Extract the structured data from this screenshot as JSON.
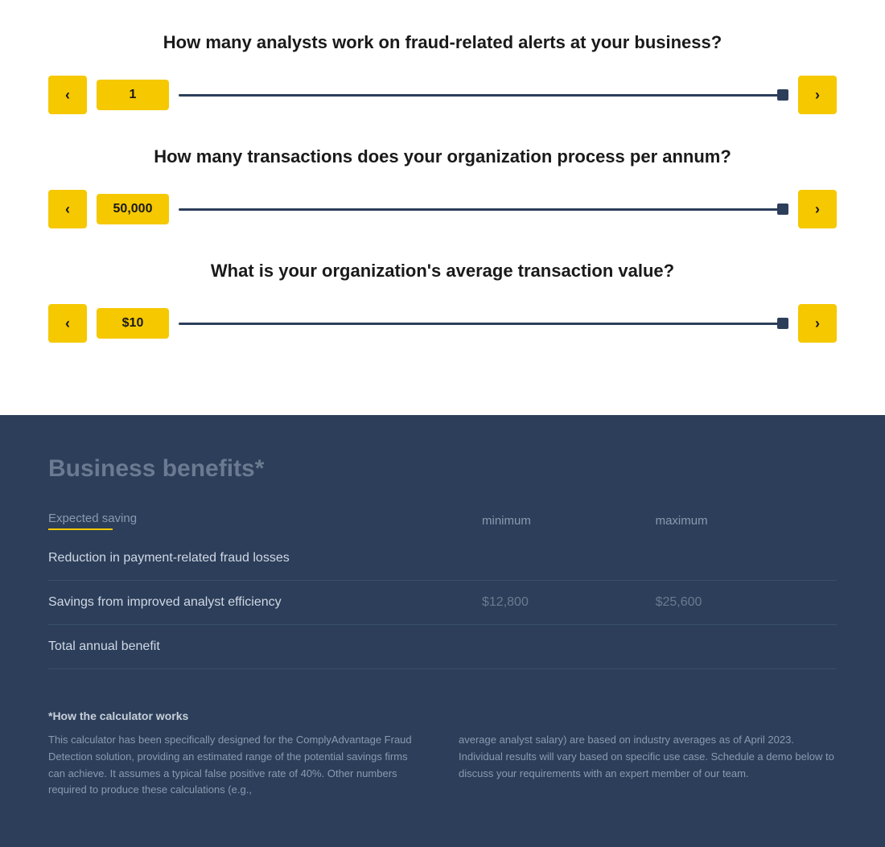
{
  "questions": [
    {
      "id": "analysts",
      "text": "How many analysts work on fraud-related alerts at your business?",
      "value": "1",
      "min": 1,
      "max": 100
    },
    {
      "id": "transactions",
      "text": "How many transactions does your organization process per annum?",
      "value": "50,000",
      "min": 1,
      "max": 1000000
    },
    {
      "id": "avg_value",
      "text": "What is your organization's average transaction value?",
      "value": "$10",
      "min": 1,
      "max": 10000
    }
  ],
  "benefits": {
    "title": "Business benefits*",
    "headers": {
      "label": "Expected saving",
      "minimum": "minimum",
      "maximum": "maximum"
    },
    "rows": [
      {
        "label": "Reduction in payment-related fraud losses",
        "minimum": "",
        "maximum": ""
      },
      {
        "label": "Savings from improved analyst efficiency",
        "minimum": "$12,800",
        "maximum": "$25,600"
      },
      {
        "label": "Total annual benefit",
        "minimum": "",
        "maximum": ""
      }
    ]
  },
  "footer": {
    "title": "*How the calculator works",
    "text_left": "This calculator has been specifically designed for the ComplyAdvantage Fraud Detection solution, providing an estimated range of the potential savings firms can achieve. It assumes a typical false positive rate of 40%. Other numbers required to produce these calculations (e.g.,",
    "text_right": "average analyst salary) are based on industry averages as of April 2023. Individual results will vary based on specific use case. Schedule a demo below to discuss your requirements with an expert member of our team."
  },
  "buttons": {
    "prev": "‹",
    "next": "›"
  }
}
